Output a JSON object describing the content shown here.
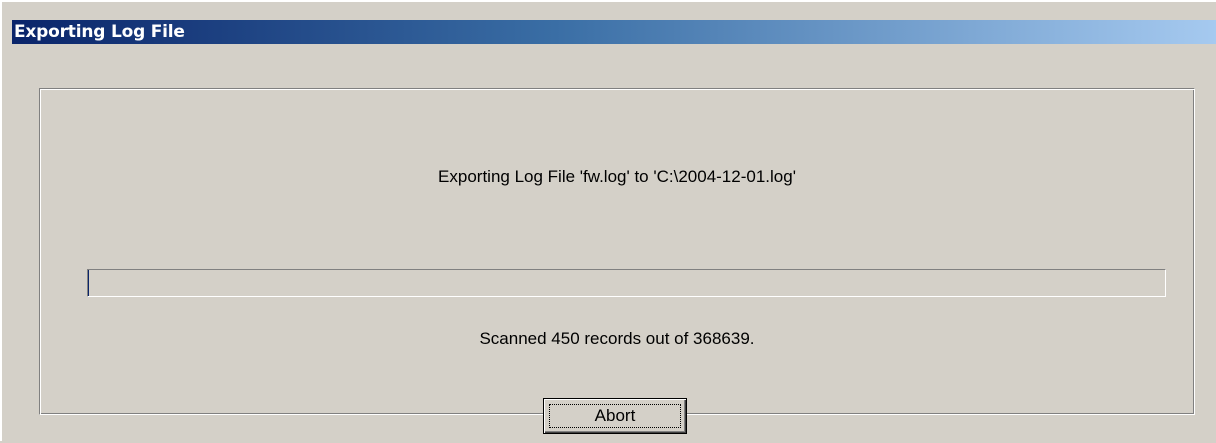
{
  "window": {
    "title": "Exporting Log File"
  },
  "dialog": {
    "message": "Exporting Log File 'fw.log' to 'C:\\2004-12-01.log'",
    "status": "Scanned 450 records out of 368639.",
    "progress": {
      "scanned": 450,
      "total": 368639
    },
    "abort_label": "Abort"
  },
  "colors": {
    "titlebar_start": "#0a246a",
    "titlebar_end": "#a6caf0",
    "dialog_bg": "#d4d0c8",
    "progress_fill": "#0a246a"
  }
}
